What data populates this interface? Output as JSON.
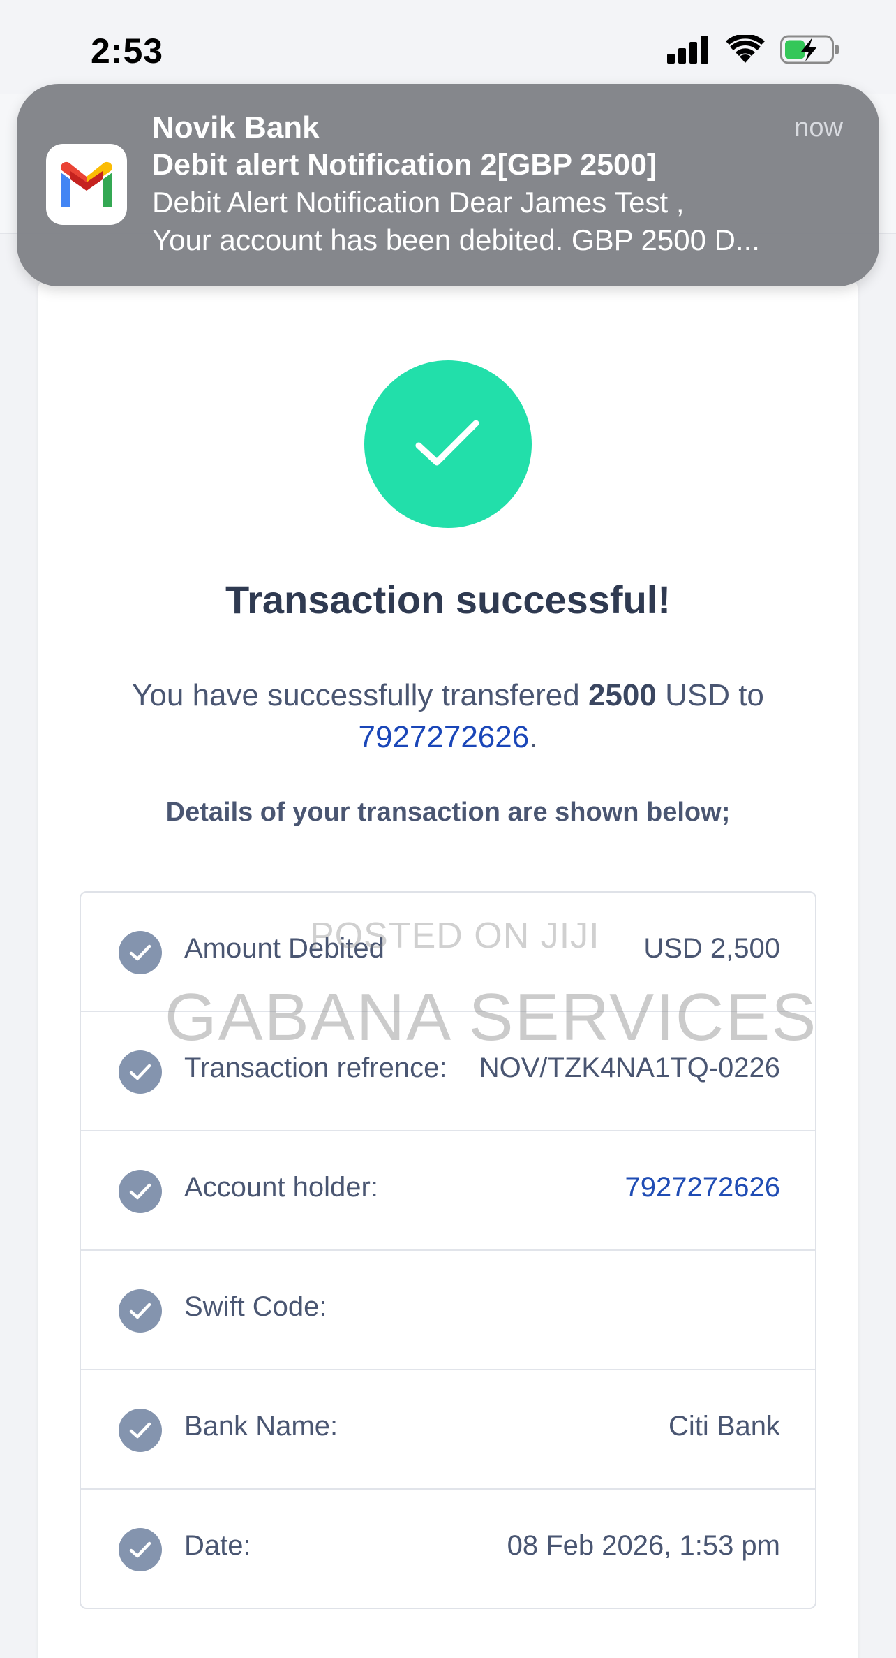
{
  "status_bar": {
    "time": "2:53"
  },
  "notification": {
    "app_name": "Novik Bank",
    "time": "now",
    "title": "Debit alert Notification 2[GBP 2500]",
    "body_line1": "Debit Alert Notification Dear James Test ,",
    "body_line2": "Your account has been debited. GBP 2500 D...",
    "icon": "gmail-icon"
  },
  "success": {
    "icon": "checkmark-icon",
    "accent_color": "#22dfaa",
    "title": "Transaction successful!",
    "msg_prefix": "You have successfully transfered ",
    "msg_amount": "2500",
    "msg_currency": " USD to",
    "msg_account": "7927272626",
    "msg_suffix": ".",
    "details_heading": "Details of your transaction are shown below;"
  },
  "details": {
    "rows": [
      {
        "label": "Amount Debited",
        "value": "USD 2,500"
      },
      {
        "label": "Transaction refrence:",
        "value": "NOV/TZK4NA1TQ-0226"
      },
      {
        "label": "Account holder:",
        "value": "7927272626"
      },
      {
        "label": "Swift Code:",
        "value": ""
      },
      {
        "label": "Bank Name:",
        "value": "Citi Bank"
      },
      {
        "label": "Date:",
        "value": "08 Feb 2026, 1:53 pm"
      }
    ]
  },
  "watermark": {
    "posted": "POSTED ON JIJI",
    "gabana": "GABANA SERVICES"
  }
}
